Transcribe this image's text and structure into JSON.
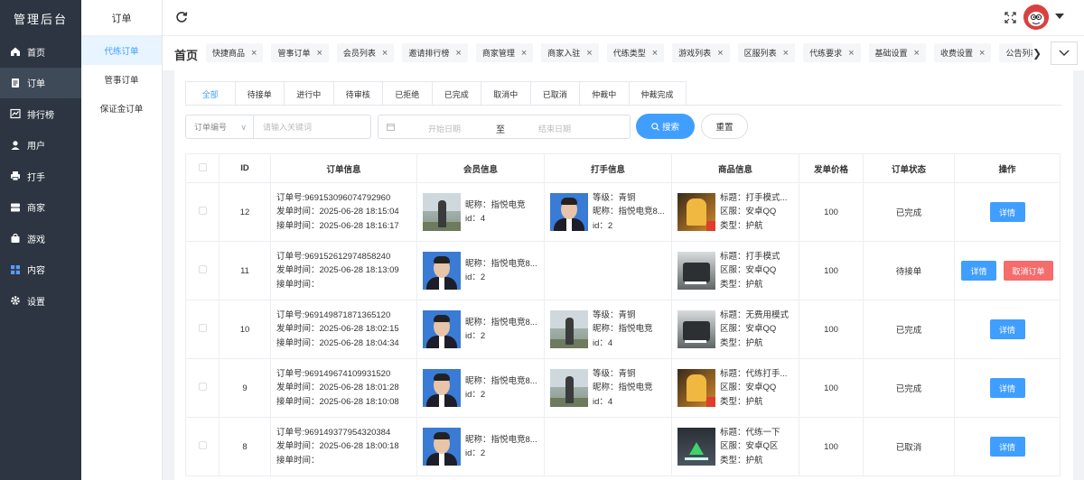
{
  "app": {
    "title": "管理后台"
  },
  "sidebar": {
    "items": [
      {
        "label": "首页",
        "icon": "home-icon"
      },
      {
        "label": "订单",
        "icon": "document-icon",
        "active": true
      },
      {
        "label": "排行榜",
        "icon": "chart-icon"
      },
      {
        "label": "用户",
        "icon": "user-icon"
      },
      {
        "label": "打手",
        "icon": "printer-icon"
      },
      {
        "label": "商家",
        "icon": "storefront-icon"
      },
      {
        "label": "游戏",
        "icon": "shopping-bag-icon"
      },
      {
        "label": "内容",
        "icon": "grid-icon"
      },
      {
        "label": "设置",
        "icon": "gear-icon"
      }
    ]
  },
  "subnav": {
    "title": "订单",
    "items": [
      {
        "label": "代练订单",
        "active": true
      },
      {
        "label": "管事订单"
      },
      {
        "label": "保证金订单"
      }
    ]
  },
  "tagsbar": {
    "home": "首页",
    "tags": [
      "快捷商品",
      "管事订单",
      "会员列表",
      "邀请排行榜",
      "商家管理",
      "商家入驻",
      "代练类型",
      "游戏列表",
      "区服列表",
      "代练要求",
      "基础设置",
      "收费设置",
      "公告列表"
    ]
  },
  "status_tabs": {
    "active": "全部",
    "items": [
      "全部",
      "待接单",
      "进行中",
      "待审核",
      "已拒绝",
      "已完成",
      "取消中",
      "已取消",
      "仲裁中",
      "仲裁完成"
    ]
  },
  "filters": {
    "select_value": "订单编号",
    "keyword_placeholder": "请输入关键词",
    "date_start_placeholder": "开始日期",
    "date_separator": "至",
    "date_end_placeholder": "结束日期",
    "search_label": "搜索",
    "reset_label": "重置"
  },
  "table": {
    "headers": [
      "ID",
      "订单信息",
      "会员信息",
      "打手信息",
      "商品信息",
      "发单价格",
      "订单状态",
      "操作"
    ],
    "detail_label": "详情",
    "cancel_label": "取消订单",
    "rows": [
      {
        "id": "12",
        "order": [
          "订单号:969153096074792960",
          "发单时间：2025-06-28 18:15:04",
          "接单时间：2025-06-28 18:16:17"
        ],
        "member": [
          "昵称：指悦电竞",
          "id：4"
        ],
        "member_photo": "outdoor",
        "worker": [
          "等级：青铜",
          "昵称：指悦电竞8...",
          "id：2"
        ],
        "worker_photo": "blue",
        "goods": [
          "标题：打手模式...",
          "区服：安卓QQ",
          "类型：护航"
        ],
        "goods_img": "a",
        "price": "100",
        "status": "已完成",
        "can_cancel": false
      },
      {
        "id": "11",
        "order": [
          "订单号:969152612974858240",
          "发单时间：2025-06-28 18:13:09",
          "接单时间："
        ],
        "member": [
          "昵称：指悦电竞8...",
          "id：2"
        ],
        "member_photo": "blue",
        "worker": [],
        "worker_photo": "",
        "goods": [
          "标题：打手模式",
          "区服：安卓QQ",
          "类型：护航"
        ],
        "goods_img": "b",
        "price": "100",
        "status": "待接单",
        "can_cancel": true
      },
      {
        "id": "10",
        "order": [
          "订单号:969149871871365120",
          "发单时间：2025-06-28 18:02:15",
          "接单时间：2025-06-28 18:04:34"
        ],
        "member": [
          "昵称：指悦电竞8...",
          "id：2"
        ],
        "member_photo": "blue",
        "worker": [
          "等级：青铜",
          "昵称：指悦电竞",
          "id：4"
        ],
        "worker_photo": "outdoor",
        "goods": [
          "标题：无费用模式",
          "区服：安卓QQ",
          "类型：护航"
        ],
        "goods_img": "b",
        "price": "100",
        "status": "已完成",
        "can_cancel": false
      },
      {
        "id": "9",
        "order": [
          "订单号:969149674109931520",
          "发单时间：2025-06-28 18:01:28",
          "接单时间：2025-06-28 18:10:08"
        ],
        "member": [
          "昵称：指悦电竞8...",
          "id：2"
        ],
        "member_photo": "blue",
        "worker": [
          "等级：青铜",
          "昵称：指悦电竞",
          "id：4"
        ],
        "worker_photo": "outdoor",
        "goods": [
          "标题：代练打手...",
          "区服：安卓QQ",
          "类型：护航"
        ],
        "goods_img": "a",
        "price": "100",
        "status": "已完成",
        "can_cancel": false
      },
      {
        "id": "8",
        "order": [
          "订单号:969149377954320384",
          "发单时间：2025-06-28 18:00:18",
          "接单时间："
        ],
        "member": [
          "昵称：指悦电竞8...",
          "id：2"
        ],
        "member_photo": "blue",
        "worker": [],
        "worker_photo": "",
        "goods": [
          "标题：代练一下",
          "区服：安卓Q区",
          "类型：护航"
        ],
        "goods_img": "c",
        "price": "100",
        "status": "已取消",
        "can_cancel": false
      }
    ]
  },
  "colors": {
    "sidebar_bg": "#2c3541",
    "primary": "#409eff",
    "danger": "#f56c6c"
  }
}
